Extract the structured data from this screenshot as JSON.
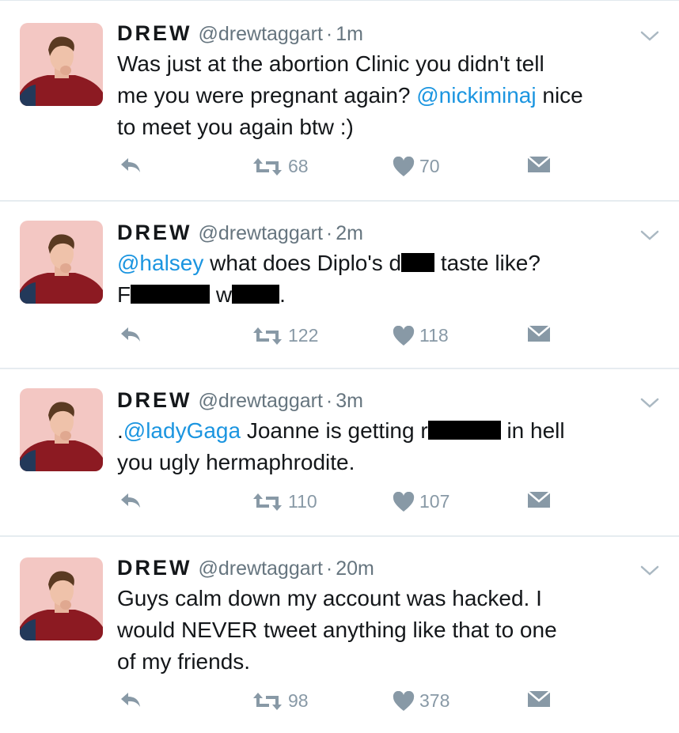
{
  "tweets": [
    {
      "name": "DREW",
      "handle": "@drewtaggart",
      "dot": "·",
      "time": "1m",
      "line1_a": "Was just at the abortion Clinic you didn't tell",
      "line2_a": "me you were pregnant again? ",
      "line2_mention": "@nickiminaj",
      "line2_b": " nice",
      "line3_a": "to meet you again btw :)",
      "retweets": "68",
      "likes": "70"
    },
    {
      "name": "DREW",
      "handle": "@drewtaggart",
      "dot": "·",
      "time": "2m",
      "line1_mention": "@halsey",
      "line1_a": " what does Diplo's d",
      "line1_b": " taste like?",
      "line2_a": "F",
      "line2_b": " w",
      "line2_c": ".",
      "retweets": "122",
      "likes": "118"
    },
    {
      "name": "DREW",
      "handle": "@drewtaggart",
      "dot": "·",
      "time": "3m",
      "line1_pre": ".",
      "line1_mention": "@ladyGaga",
      "line1_a": " Joanne is getting r",
      "line1_b": " in hell",
      "line2_a": "you ugly hermaphrodite.",
      "retweets": "110",
      "likes": "107"
    },
    {
      "name": "DREW",
      "handle": "@drewtaggart",
      "dot": "·",
      "time": "20m",
      "line1_a": "Guys calm down my account was hacked. I",
      "line2_a": "would NEVER tweet anything like that to one",
      "line3_a": "of my friends.",
      "retweets": "98",
      "likes": "378"
    }
  ],
  "icons": {
    "reply": "reply-icon",
    "retweet": "retweet-icon",
    "like": "heart-icon",
    "dm": "direct-message-icon",
    "more": "chevron-down-icon"
  },
  "colors": {
    "text": "#14171a",
    "muted": "#66757f",
    "action": "#8899a6",
    "mention": "#1b95e0",
    "divider": "#e6ecf0"
  }
}
